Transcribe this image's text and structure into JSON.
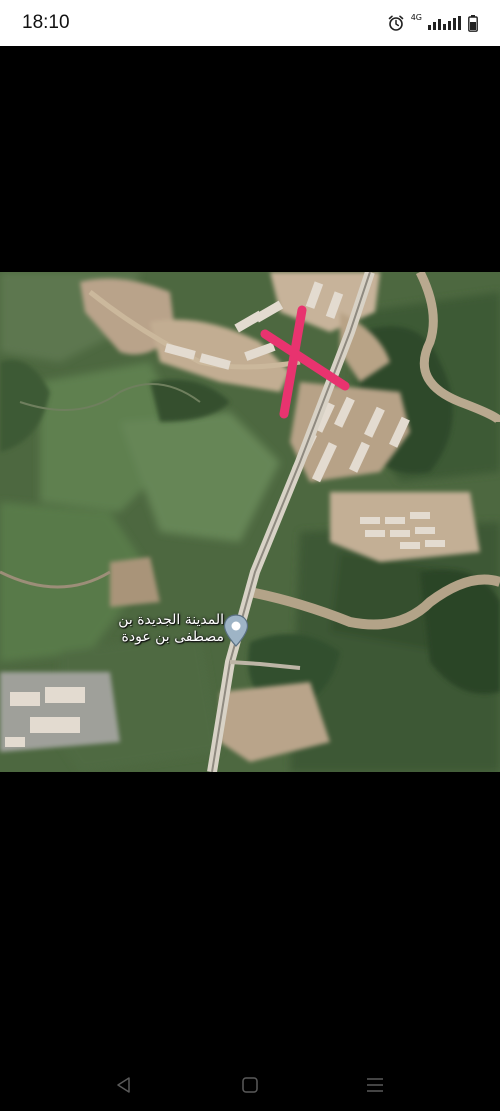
{
  "status_bar": {
    "time": "18:10",
    "network_type": "4G",
    "icons": [
      "alarm-icon",
      "signal-icon",
      "battery-icon"
    ]
  },
  "map": {
    "place_label_line1": "المدينة الجديدة بن",
    "place_label_line2": "مصطفى بن عودة",
    "marker_icon": "location-pin-icon",
    "cross_mark_color": "#e8336f"
  },
  "navigation_bar": {
    "icons": [
      "back-icon",
      "home-icon",
      "recents-icon"
    ]
  }
}
